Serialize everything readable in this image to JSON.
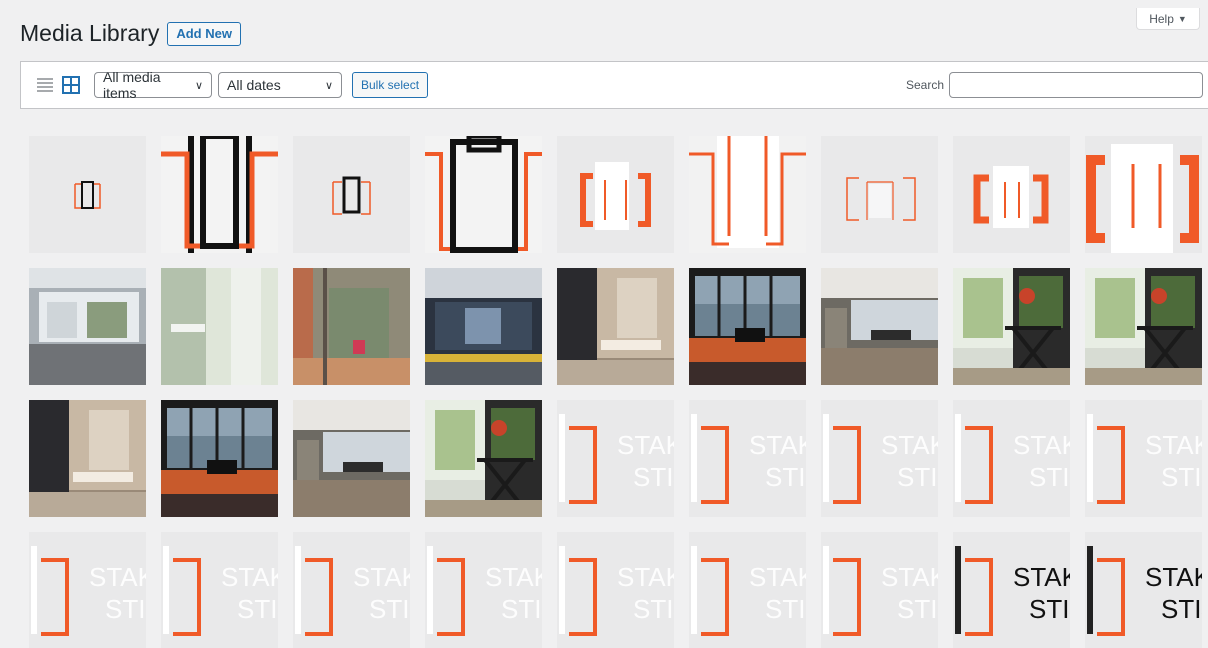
{
  "header": {
    "title": "Media Library",
    "add_new": "Add New"
  },
  "help": {
    "label": "Help",
    "arrow": "▼"
  },
  "toolbar": {
    "list_view_icon": "list-view-icon",
    "grid_view_icon": "grid-view-icon",
    "media_filter": "All media items",
    "date_filter": "All dates",
    "bulk_select": "Bulk select",
    "search_label": "Search",
    "search_value": ""
  },
  "colors": {
    "accent": "#2271b1",
    "orange": "#f05a28",
    "dark": "#111111"
  },
  "media": [
    {
      "kind": "logo-small-black",
      "label": ""
    },
    {
      "kind": "logo-zoom-black",
      "label": ""
    },
    {
      "kind": "logo-mid-black",
      "label": ""
    },
    {
      "kind": "logo-bigzoom-black",
      "label": ""
    },
    {
      "kind": "logo-orange-white",
      "label": ""
    },
    {
      "kind": "logo-zoom-white",
      "label": ""
    },
    {
      "kind": "logo-outline-orange",
      "label": ""
    },
    {
      "kind": "logo-orange-white-2",
      "label": ""
    },
    {
      "kind": "logo-orange-big",
      "label": ""
    },
    {
      "kind": "photo-office",
      "label": ""
    },
    {
      "kind": "photo-bathroom",
      "label": ""
    },
    {
      "kind": "photo-glass-door",
      "label": ""
    },
    {
      "kind": "photo-office-dark",
      "label": ""
    },
    {
      "kind": "photo-bath-warm",
      "label": ""
    },
    {
      "kind": "photo-piano-lake",
      "label": ""
    },
    {
      "kind": "photo-lounge",
      "label": ""
    },
    {
      "kind": "photo-flowers-table",
      "label": ""
    },
    {
      "kind": "photo-flowers-table",
      "label": ""
    },
    {
      "kind": "photo-bath-warm",
      "label": ""
    },
    {
      "kind": "photo-piano-lake",
      "label": ""
    },
    {
      "kind": "photo-lounge",
      "label": ""
    },
    {
      "kind": "photo-flowers-table",
      "label": ""
    },
    {
      "kind": "logo-text",
      "label": "STAK",
      "label2": "STIJ"
    },
    {
      "kind": "logo-text",
      "label": "STAK",
      "label2": "STIJ"
    },
    {
      "kind": "logo-text",
      "label": "STAK",
      "label2": "STIJ"
    },
    {
      "kind": "logo-text",
      "label": "STAK",
      "label2": "STIJ"
    },
    {
      "kind": "logo-text",
      "label": "STAK",
      "label2": "STIJ"
    },
    {
      "kind": "logo-text",
      "label": "STAK",
      "label2": "STIJ"
    },
    {
      "kind": "logo-text",
      "label": "STAK",
      "label2": "STIJ"
    },
    {
      "kind": "logo-text",
      "label": "STAK",
      "label2": "STIJ"
    },
    {
      "kind": "logo-text",
      "label": "STAK",
      "label2": "STIJ"
    },
    {
      "kind": "logo-text",
      "label": "STAK",
      "label2": "STIJ"
    },
    {
      "kind": "logo-text",
      "label": "STAK",
      "label2": "STIJ"
    },
    {
      "kind": "logo-text",
      "label": "STAK",
      "label2": "STIJ"
    },
    {
      "kind": "logo-text-dark",
      "label": "STAK",
      "label2": "STIJ"
    },
    {
      "kind": "logo-text-dark",
      "label": "STAK",
      "label2": "STIJ"
    }
  ]
}
